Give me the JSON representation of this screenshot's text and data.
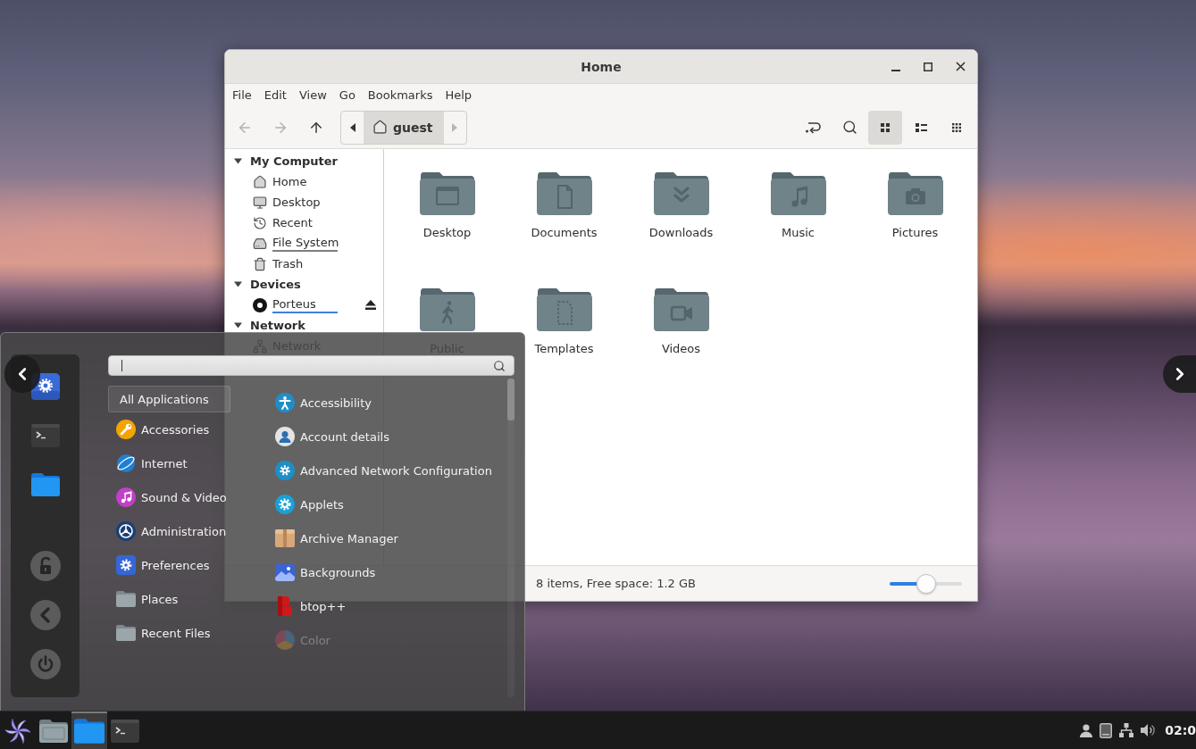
{
  "file_manager": {
    "title": "Home",
    "window_controls": [
      {
        "kind": "minimize"
      },
      {
        "kind": "maximize"
      },
      {
        "kind": "close"
      }
    ],
    "menu": [
      "File",
      "Edit",
      "View",
      "Go",
      "Bookmarks",
      "Help"
    ],
    "toolbar": {
      "nav": [
        {
          "kind": "back",
          "disabled": true
        },
        {
          "kind": "forward",
          "disabled": true
        },
        {
          "kind": "up",
          "disabled": false
        }
      ],
      "path_bar": {
        "arrows": [
          {
            "kind": "left",
            "disabled": false
          },
          {
            "kind": "right",
            "disabled": true
          }
        ],
        "crumbs": [
          {
            "label": "guest",
            "selected": true
          }
        ]
      },
      "tools": [
        {
          "kind": "location"
        },
        {
          "kind": "search"
        }
      ],
      "views": [
        {
          "kind": "icons",
          "selected": true
        },
        {
          "kind": "list",
          "selected": false
        },
        {
          "kind": "compact",
          "selected": false
        }
      ]
    },
    "sidebar": [
      {
        "title": "My Computer",
        "expanded": true,
        "children": [
          {
            "label": "Home",
            "kind": "home"
          },
          {
            "label": "Desktop",
            "kind": "desktop"
          },
          {
            "label": "Recent",
            "kind": "recent"
          },
          {
            "label": "File System",
            "kind": "drive",
            "color": "#7e7e7e"
          },
          {
            "label": "Trash",
            "kind": "trash"
          }
        ]
      },
      {
        "title": "Devices",
        "expanded": true,
        "children": [
          {
            "label": "Porteus",
            "kind": "disc",
            "color": "#3b82d9"
          }
        ]
      },
      {
        "title": "Network",
        "expanded": true,
        "children": [
          {
            "label": "Network",
            "kind": "network"
          }
        ]
      }
    ],
    "folders": [
      {
        "name": "Desktop",
        "kind": "desktop"
      },
      {
        "name": "Documents",
        "kind": "documents"
      },
      {
        "name": "Downloads",
        "kind": "downloads"
      },
      {
        "name": "Music",
        "kind": "music"
      },
      {
        "name": "Pictures",
        "kind": "pictures"
      },
      {
        "name": "Public",
        "kind": "public"
      },
      {
        "name": "Templates",
        "kind": "templates"
      },
      {
        "name": "Videos",
        "kind": "videos"
      }
    ],
    "status_bar": {
      "text": "8 items, Free space: 1.2 GB",
      "zoom": {
        "level": 0.5
      }
    }
  },
  "app_menu": {
    "favorites": [
      {
        "kind": "settings"
      },
      {
        "kind": "terminal"
      },
      {
        "kind": "files"
      }
    ],
    "session": [
      {
        "kind": "lock"
      },
      {
        "kind": "logout"
      },
      {
        "kind": "shutdown"
      }
    ],
    "search": {
      "focused": true
    },
    "categories": [
      {
        "label": "All Applications",
        "kind": "all",
        "selected": true
      },
      {
        "label": "Accessories",
        "kind": "accessories",
        "selected": false
      },
      {
        "label": "Internet",
        "kind": "internet",
        "selected": false
      },
      {
        "label": "Sound & Video",
        "kind": "sound-video",
        "selected": false
      },
      {
        "label": "Administration",
        "kind": "administration",
        "selected": false
      },
      {
        "label": "Preferences",
        "kind": "preferences",
        "selected": false
      },
      {
        "label": "Places",
        "kind": "places",
        "selected": false
      },
      {
        "label": "Recent Files",
        "kind": "recent",
        "selected": false
      }
    ],
    "apps": [
      {
        "label": "Accessibility",
        "kind": "accessibility",
        "dimmed": false
      },
      {
        "label": "Account details",
        "kind": "account",
        "dimmed": false
      },
      {
        "label": "Advanced Network Configuration",
        "kind": "network-config",
        "dimmed": false
      },
      {
        "label": "Applets",
        "kind": "applets",
        "dimmed": false
      },
      {
        "label": "Archive Manager",
        "kind": "archive",
        "dimmed": false
      },
      {
        "label": "Backgrounds",
        "kind": "backgrounds",
        "dimmed": false
      },
      {
        "label": "btop++",
        "kind": "btop",
        "dimmed": false
      },
      {
        "label": "Color",
        "kind": "color",
        "dimmed": true
      }
    ]
  },
  "viewer_nav": [
    {
      "kind": "previous"
    },
    {
      "kind": "next"
    }
  ],
  "taskbar": {
    "launchers": [
      {
        "kind": "menu",
        "active": false
      },
      {
        "kind": "file-manager",
        "active": false
      },
      {
        "kind": "files",
        "active": true
      },
      {
        "kind": "terminal",
        "active": false
      }
    ],
    "tray": [
      {
        "kind": "user"
      },
      {
        "kind": "drive"
      },
      {
        "kind": "network"
      },
      {
        "kind": "volume"
      }
    ],
    "clock": "02:0"
  }
}
